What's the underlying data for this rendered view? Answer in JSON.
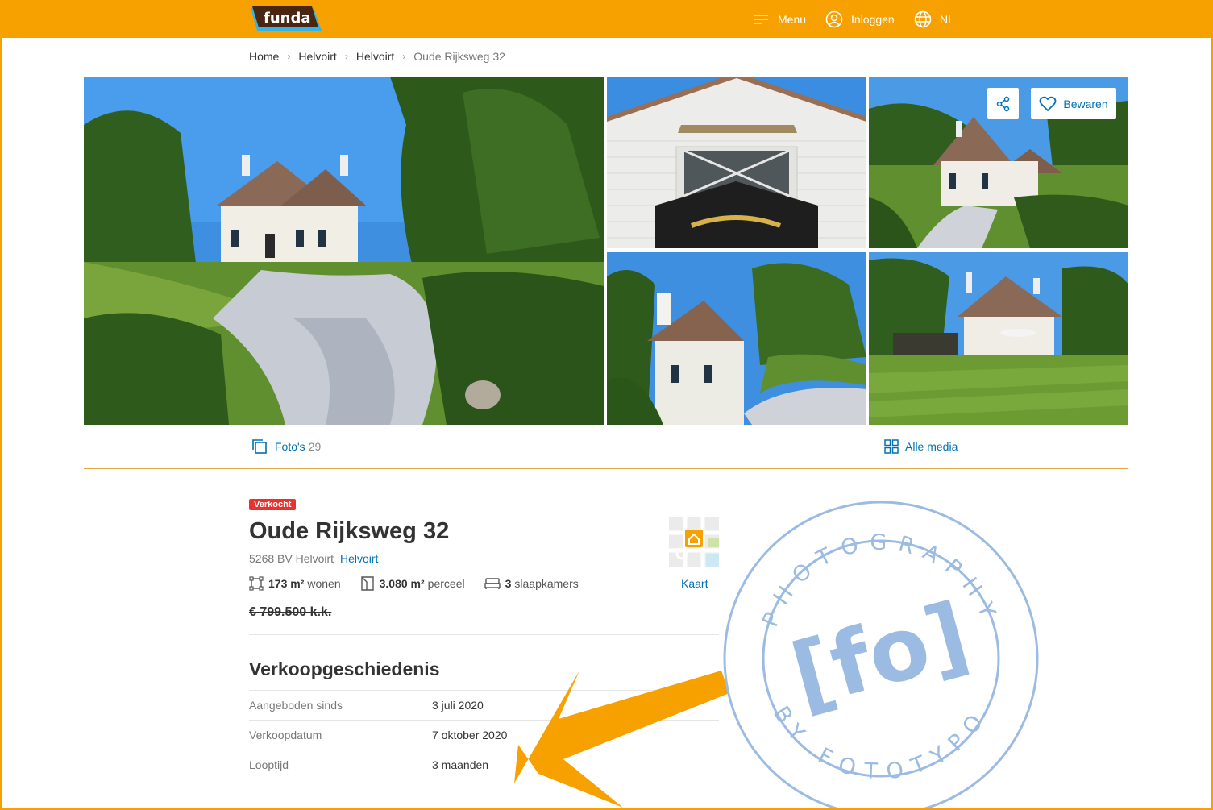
{
  "header": {
    "logo_text": "funda",
    "menu_label": "Menu",
    "login_label": "Inloggen",
    "language_label": "NL",
    "brand_color": "#f7a100"
  },
  "breadcrumb": [
    "Home",
    "Helvoirt",
    "Helvoirt",
    "Oude Rijksweg 32"
  ],
  "gallery": {
    "share_icon": "share-icon",
    "save_label": "Bewaren",
    "photos_label": "Foto's",
    "photos_count": "29",
    "all_media_label": "Alle media"
  },
  "listing": {
    "status_badge": "Verkocht",
    "title": "Oude Rijksweg 32",
    "postal_city": "5268 BV Helvoirt",
    "city_link": "Helvoirt",
    "living_area": "173 m²",
    "living_label": "wonen",
    "plot_area": "3.080 m²",
    "plot_label": "perceel",
    "bedrooms": "3",
    "bedrooms_label": "slaapkamers",
    "price": "€ 799.500 k.k.",
    "map_label": "Kaart",
    "status_color": "#e8322d",
    "link_color": "#0071b3"
  },
  "history": {
    "title": "Verkoopgeschiedenis",
    "rows": [
      {
        "label": "Aangeboden sinds",
        "value": "3 juli 2020"
      },
      {
        "label": "Verkoopdatum",
        "value": "7 oktober 2020"
      },
      {
        "label": "Looptijd",
        "value": "3 maanden"
      }
    ]
  },
  "watermark": {
    "center_text": "[fo]",
    "ring_top": "PHOTOGRAPHY",
    "ring_bottom": "BY FOTOTYPO"
  }
}
